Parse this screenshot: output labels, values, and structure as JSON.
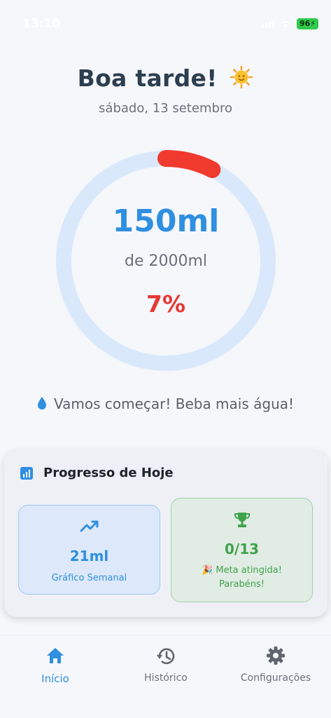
{
  "status_bar": {
    "time": "13:10",
    "battery": "96"
  },
  "header": {
    "greeting": "Boa tarde!",
    "date": "sábado, 13 setembro"
  },
  "progress_ring": {
    "consumed": "150ml",
    "goal": "de 2000ml",
    "percent": "7%",
    "fraction": 0.075,
    "track_color": "#d9e9fb",
    "fill_color": "#f03a2e"
  },
  "motivation": {
    "text": "Vamos começar! Beba mais água!"
  },
  "today_progress": {
    "title": "Progresso de Hoje",
    "weekly": {
      "value": "21ml",
      "label": "Gráfico Semanal"
    },
    "goals": {
      "value": "0/13",
      "label_line1": "🎉 Meta atingida!",
      "label_line2": "Parabéns!"
    }
  },
  "bottom_nav": {
    "home": "Início",
    "history": "Histórico",
    "settings": "Configurações"
  },
  "colors": {
    "accent": "#2f8fe0",
    "success": "#3fa34d",
    "danger": "#e53935"
  }
}
